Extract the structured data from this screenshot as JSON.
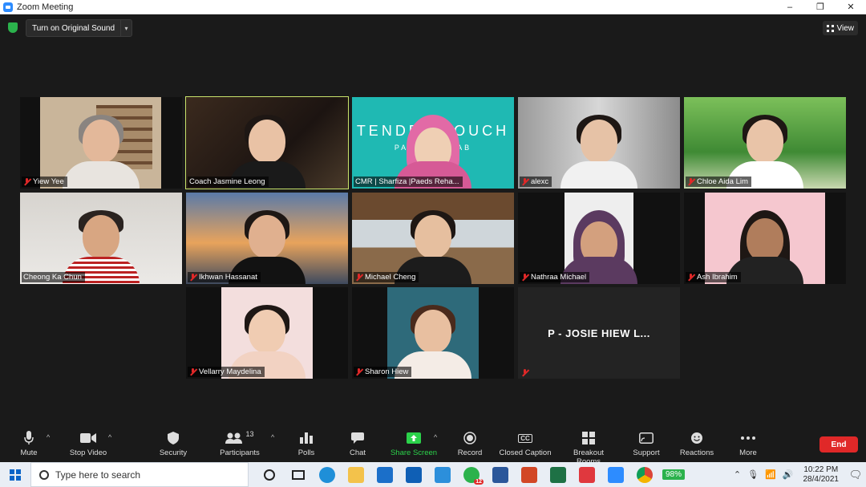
{
  "window": {
    "title": "Zoom Meeting",
    "minimize": "–",
    "maximize": "❐",
    "close": "✕"
  },
  "topbar": {
    "original_sound_label": "Turn on Original Sound",
    "original_sound_arrow": "▾",
    "view_label": "View"
  },
  "participants": [
    {
      "name": "Yiew Yee",
      "muted": true,
      "active": false
    },
    {
      "name": "Coach Jasmine Leong",
      "muted": false,
      "active": true
    },
    {
      "name": "CMR | Sharfiza |Paeds Reha...",
      "muted": false,
      "active": false,
      "background_text_1": "TENDER TOUCH",
      "background_text_2": "PAEDS REHAB"
    },
    {
      "name": "alexc",
      "muted": true,
      "active": false
    },
    {
      "name": "Chloe Aida Lim",
      "muted": true,
      "active": false
    },
    {
      "name": "Cheong Ka Chun",
      "muted": false,
      "active": false
    },
    {
      "name": "Ikhwan Hassanat",
      "muted": true,
      "active": false
    },
    {
      "name": "Michael Cheng",
      "muted": true,
      "active": false
    },
    {
      "name": "Nathraa Michael",
      "muted": true,
      "active": false
    },
    {
      "name": "Ash Ibrahim",
      "muted": true,
      "active": false
    },
    {
      "name": "Vellarry Maydelina",
      "muted": true,
      "active": false
    },
    {
      "name": "Sharon Hiew",
      "muted": true,
      "active": false
    },
    {
      "name": "",
      "muted": true,
      "active": false,
      "display_name": "P - JOSIE HIEW L..."
    }
  ],
  "toolbar": {
    "mute": "Mute",
    "stop_video": "Stop Video",
    "security": "Security",
    "participants": "Participants",
    "participants_count": "13",
    "polls": "Polls",
    "chat": "Chat",
    "share_screen": "Share Screen",
    "record": "Record",
    "closed_caption": "Closed Caption",
    "closed_caption_icon_text": "CC",
    "breakout_rooms": "Breakout Rooms",
    "support": "Support",
    "reactions": "Reactions",
    "more": "More",
    "end": "End",
    "caret": "^"
  },
  "taskbar": {
    "search_placeholder": "Type here to search",
    "whatsapp_badge": "12",
    "battery": "98%",
    "time": "10:22 PM",
    "date": "28/4/2021"
  },
  "colors": {
    "accent_blue": "#2d8cff",
    "active_speaker": "#c8e36b",
    "end_red": "#e02828",
    "share_green": "#2bd24a"
  }
}
